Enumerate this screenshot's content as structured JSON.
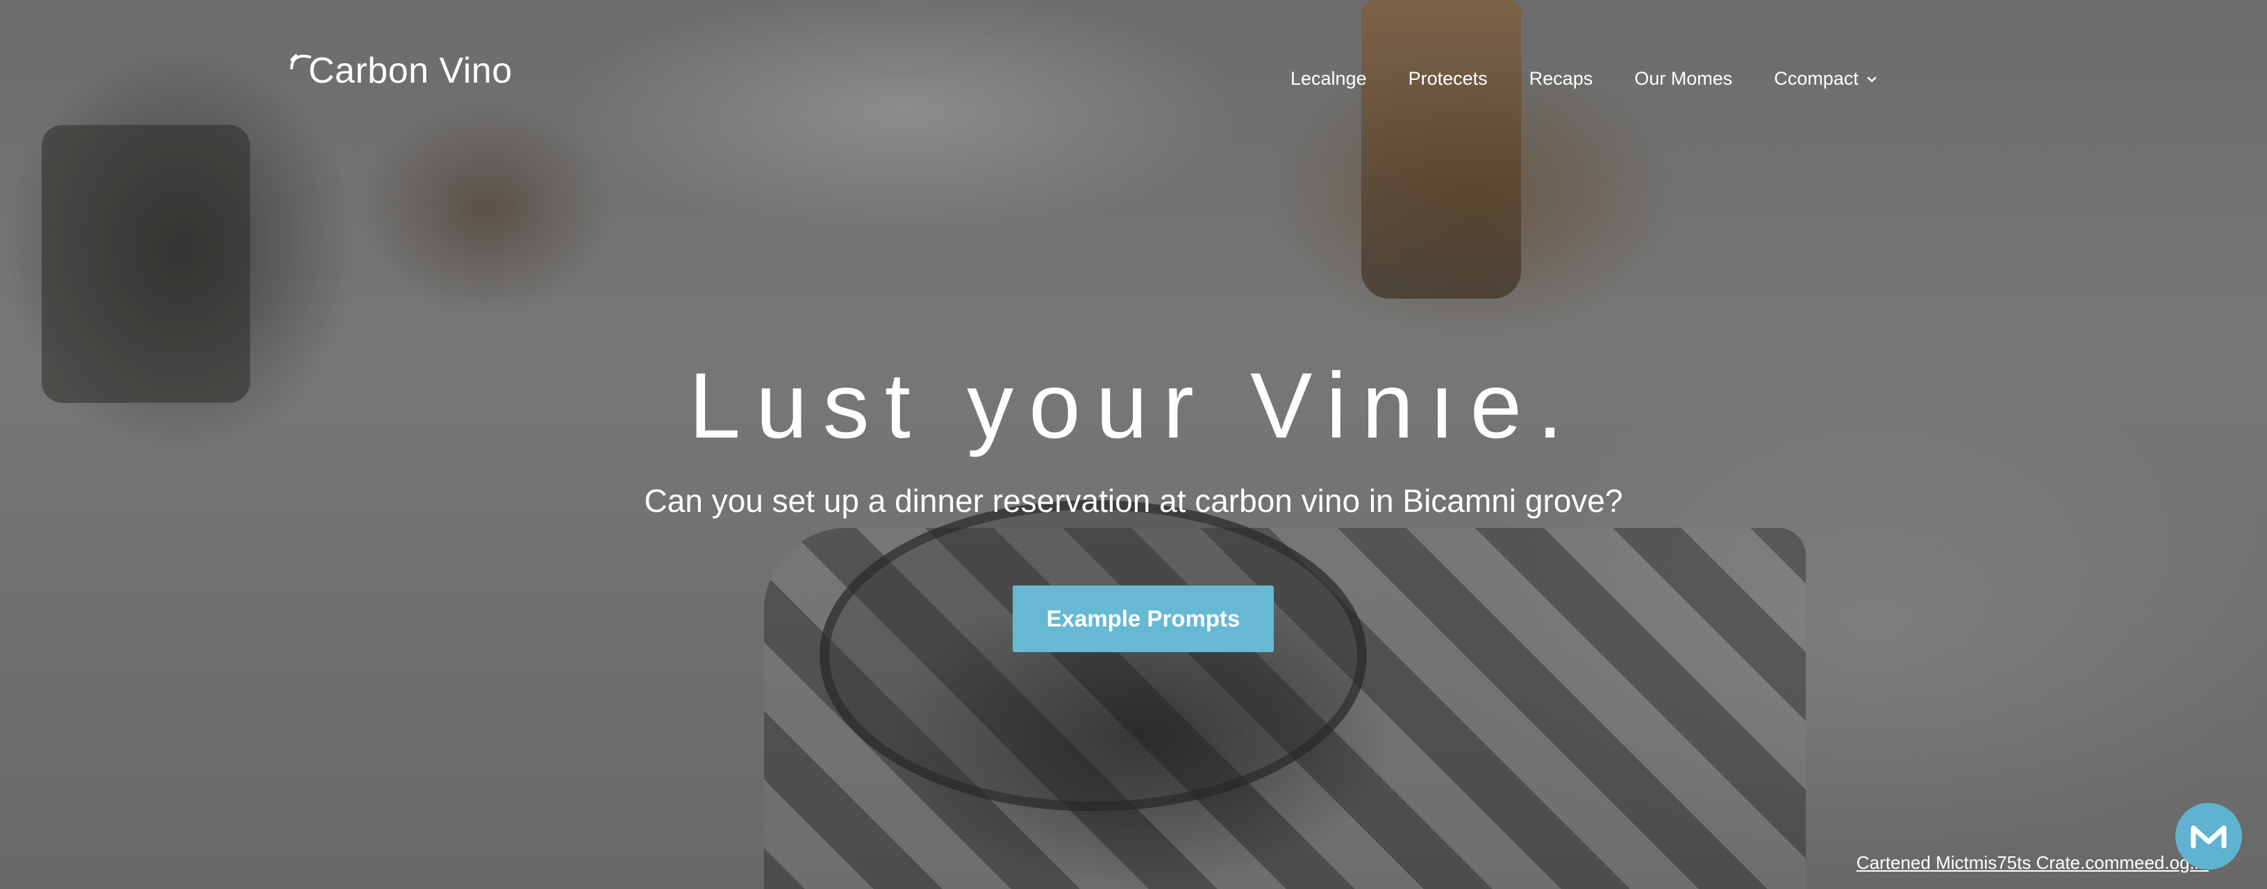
{
  "brand": {
    "name": "Carbon Vino",
    "logo_icon": "wave-mark-icon"
  },
  "nav": {
    "items": [
      {
        "label": "Lecalnge"
      },
      {
        "label": "Protecets"
      },
      {
        "label": "Recaps"
      },
      {
        "label": "Our Momes"
      },
      {
        "label": "Ccompact",
        "icon": "chevron-down-icon"
      }
    ]
  },
  "hero": {
    "headline": "Lust your Vinıe.",
    "subheadline": "Can you set up a dinner reservation at carbon vino in Bicamni grove?",
    "cta_label": "Example Prompts"
  },
  "footer": {
    "link_text": "Cartened Mictmis75ts Crate.commeed.og.in"
  },
  "chat": {
    "icon": "m-logo-icon",
    "color": "#5fb3d0"
  },
  "colors": {
    "accent": "#67b8d3",
    "text": "#ffffff"
  }
}
